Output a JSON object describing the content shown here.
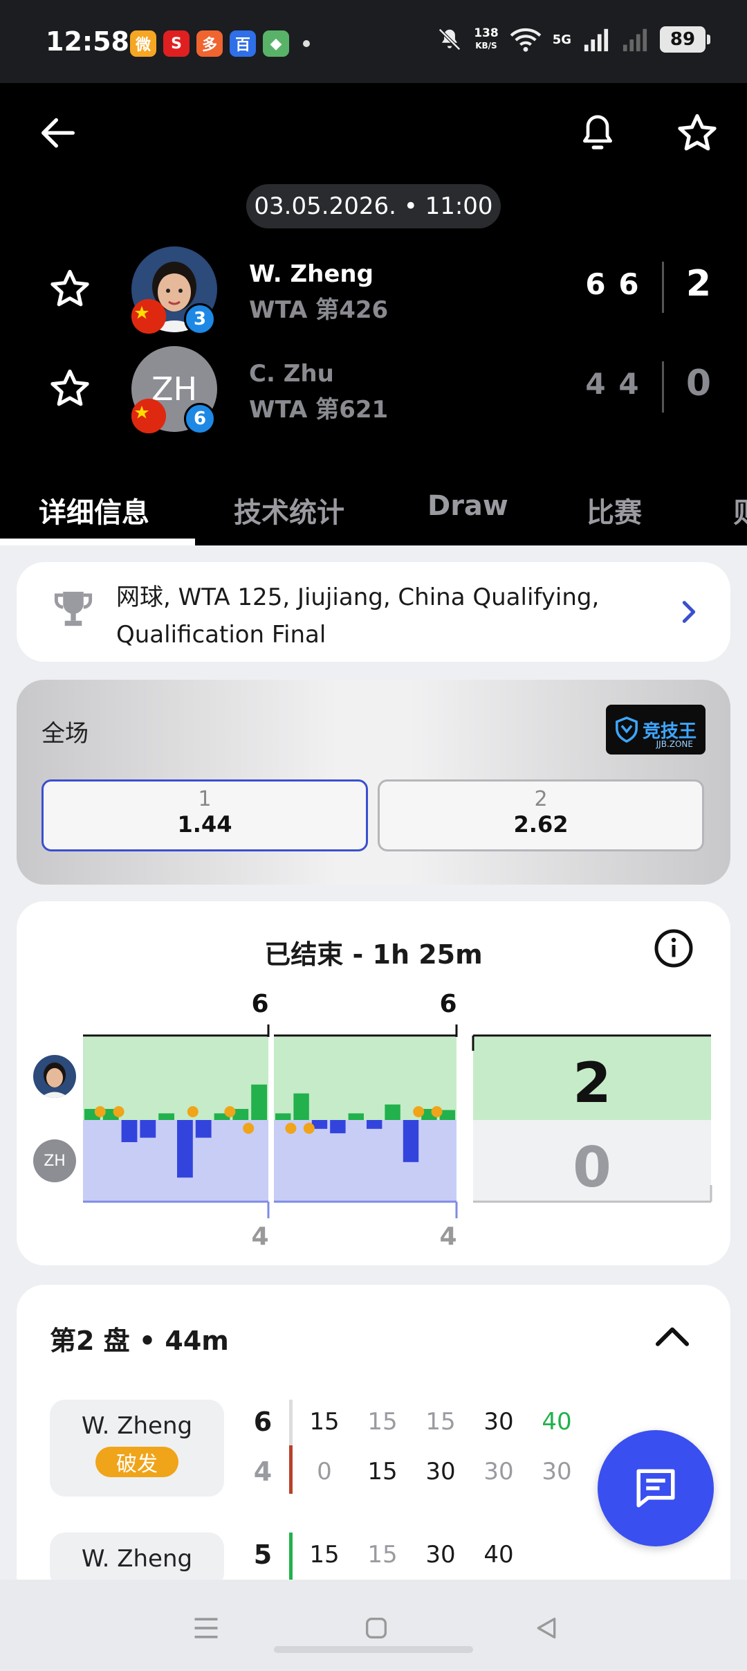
{
  "status_bar": {
    "time": "12:58",
    "apps": [
      {
        "icon": "weibo-icon",
        "color": "#f5a623",
        "glyph": "微"
      },
      {
        "icon": "people-daily-icon",
        "color": "#e02020",
        "glyph": "S"
      },
      {
        "icon": "pinduoduo-icon",
        "color": "#f06430",
        "glyph": "多"
      },
      {
        "icon": "baidu-icon",
        "color": "#2f6fe8",
        "glyph": "百"
      },
      {
        "icon": "app-icon",
        "color": "#58b368",
        "glyph": "◆"
      }
    ],
    "net_speed_value": "138",
    "net_speed_unit": "KB/S",
    "network": "5G",
    "battery": "89"
  },
  "header": {
    "back_icon": "arrow-left-icon",
    "bell_icon": "bell-icon",
    "favorite_icon": "star-outline-icon",
    "datetime": "03.05.2026. • 11:00"
  },
  "players": [
    {
      "name": "W. Zheng",
      "rank": "WTA 第426",
      "seed": "3",
      "sets": [
        "6",
        "6"
      ],
      "total": "2",
      "winner": true
    },
    {
      "name": "C. Zhu",
      "rank": "WTA 第621",
      "seed": "6",
      "initials": "ZH",
      "sets": [
        "4",
        "4"
      ],
      "total": "0",
      "winner": false
    }
  ],
  "tabs": [
    "详细信息",
    "技术统计",
    "Draw",
    "比赛",
    "则"
  ],
  "tournament": {
    "icon": "trophy-icon",
    "text": "网球, WTA 125, Jiujiang, China Qualifying, Qualification Final"
  },
  "odds": {
    "title": "全场",
    "logo_main": "竞技王",
    "logo_sub": "JJB.ZONE",
    "options": [
      {
        "label": "1",
        "value": "1.44",
        "selected": true
      },
      {
        "label": "2",
        "value": "2.62",
        "selected": false
      }
    ]
  },
  "momentum": {
    "title": "已结束 - 1h 25m",
    "p1_initials": "",
    "p2_initials": "ZH",
    "set_scores_top": [
      "6",
      "6"
    ],
    "set_scores_bottom": [
      "4",
      "4"
    ],
    "final_top": "2",
    "final_bottom": "0",
    "set1_bars": [
      1,
      1,
      -2,
      -1.6,
      0.6,
      -5.2,
      -1.6,
      0.6,
      1,
      3.2
    ],
    "set2_bars": [
      0.6,
      2.4,
      -0.8,
      -1.2,
      0.6,
      -0.8,
      1.4,
      -3.8,
      1,
      0.9
    ],
    "set1_breaks": [
      [
        1,
        "top"
      ],
      [
        2,
        "top"
      ],
      [
        6,
        "top"
      ],
      [
        8,
        "top"
      ],
      [
        9,
        "bottom"
      ]
    ],
    "set2_breaks": [
      [
        1,
        "bottom"
      ],
      [
        2,
        "bottom"
      ],
      [
        8,
        "top"
      ],
      [
        9,
        "top"
      ]
    ]
  },
  "set_detail": {
    "title": "第2 盘 • 44m",
    "collapse_icon": "chevron-up-icon",
    "games": [
      {
        "server": "W. Zheng",
        "badge": "破发",
        "score_top": "6",
        "score_bottom": "4",
        "points_top": [
          "15",
          "15",
          "15",
          "30",
          "40"
        ],
        "points_bottom": [
          "0",
          "15",
          "30",
          "30",
          "30"
        ]
      },
      {
        "server": "W. Zheng",
        "badge": "",
        "score_top": "5",
        "points_top": [
          "15",
          "15",
          "30",
          "40"
        ]
      }
    ]
  },
  "chat_icon": "chat-icon",
  "nav": {
    "menu_icon": "menu-icon",
    "home_icon": "home-square-icon",
    "back_icon": "back-triangle-icon"
  },
  "colors": {
    "win_green": "#22b14c",
    "lose_blue": "#3344dd",
    "break_orange": "#f0a419",
    "accent_blue": "#3a4ff0"
  }
}
